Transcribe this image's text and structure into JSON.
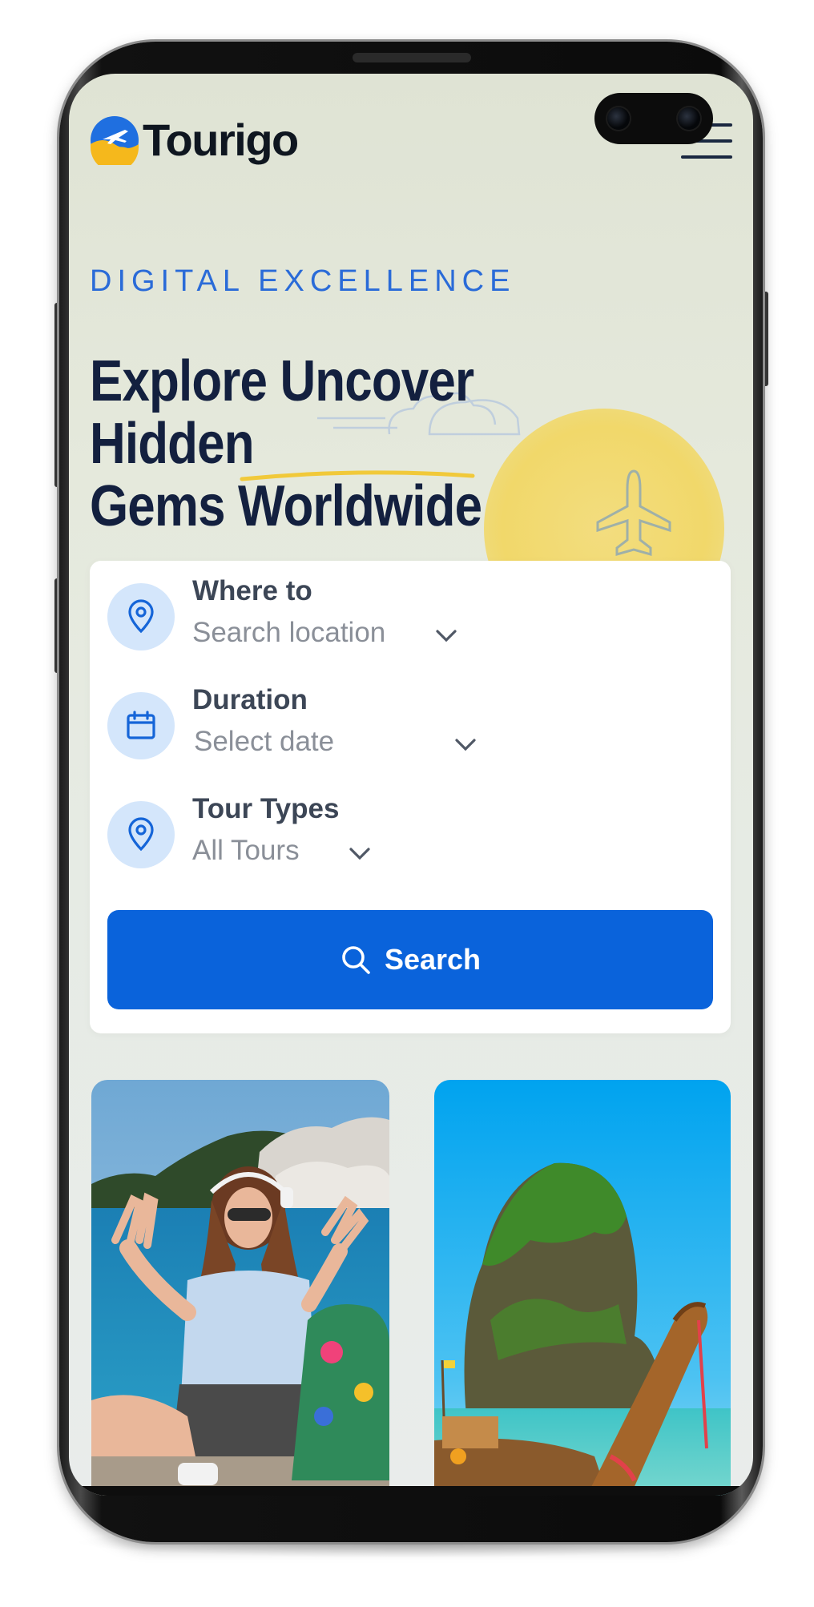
{
  "header": {
    "logo_text": "Tourigo",
    "logo_icon": "plane-logo-icon",
    "menu_icon": "hamburger-menu-icon"
  },
  "hero": {
    "eyebrow": "DIGITAL EXCELLENCE",
    "title_line1": "Explore Uncover Hidden",
    "title_line2": "Gems Worldwide"
  },
  "search_form": {
    "fields": [
      {
        "label": "Where to",
        "value": "Search location",
        "icon": "location-pin-icon"
      },
      {
        "label": "Duration",
        "value": "Select date",
        "icon": "calendar-icon"
      },
      {
        "label": "Tour Types",
        "value": "All Tours",
        "icon": "location-pin-icon"
      }
    ],
    "button_label": "Search",
    "button_icon": "search-icon"
  },
  "gallery": {
    "images": [
      {
        "subject": "woman-traveler-beach-photo"
      },
      {
        "subject": "tropical-island-longtail-boat-photo"
      }
    ]
  },
  "colors": {
    "brand_blue": "#0a63db",
    "heading_navy": "#13203f",
    "eyebrow_blue": "#2a6bd8",
    "sun_yellow": "#f1d86a",
    "logo_yellow": "#f5b81c",
    "icon_bg": "#d4e6fb"
  }
}
